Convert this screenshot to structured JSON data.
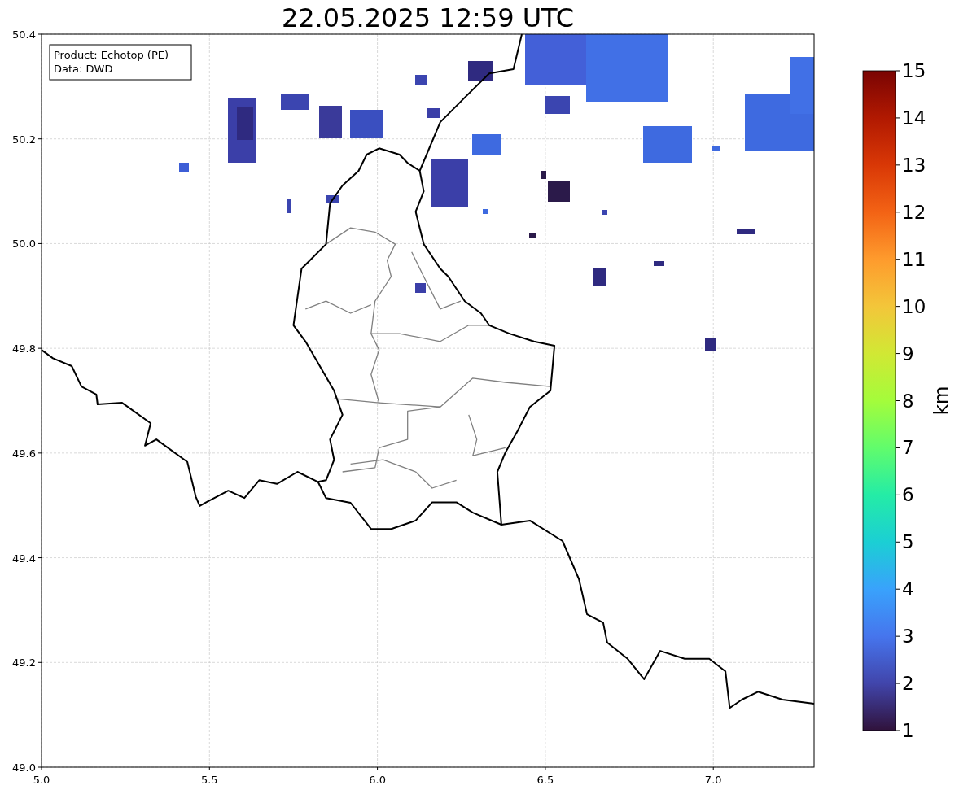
{
  "title": "22.05.2025 12:59 UTC",
  "annotation": {
    "lines": [
      "Product: Echotop (PE)",
      "Data: DWD"
    ]
  },
  "y_ticks": [
    "50.4",
    "50.2",
    "50.0",
    "49.8",
    "49.6",
    "49.4",
    "49.2",
    "49.0"
  ],
  "x_ticks": [
    "5.0",
    "5.5",
    "6.0",
    "6.5",
    "7.0"
  ],
  "colorbar": {
    "label": "km",
    "ticks": [
      "15",
      "14",
      "13",
      "12",
      "11",
      "10",
      "9",
      "8",
      "7",
      "6",
      "5",
      "4",
      "3",
      "2",
      "1"
    ]
  }
}
